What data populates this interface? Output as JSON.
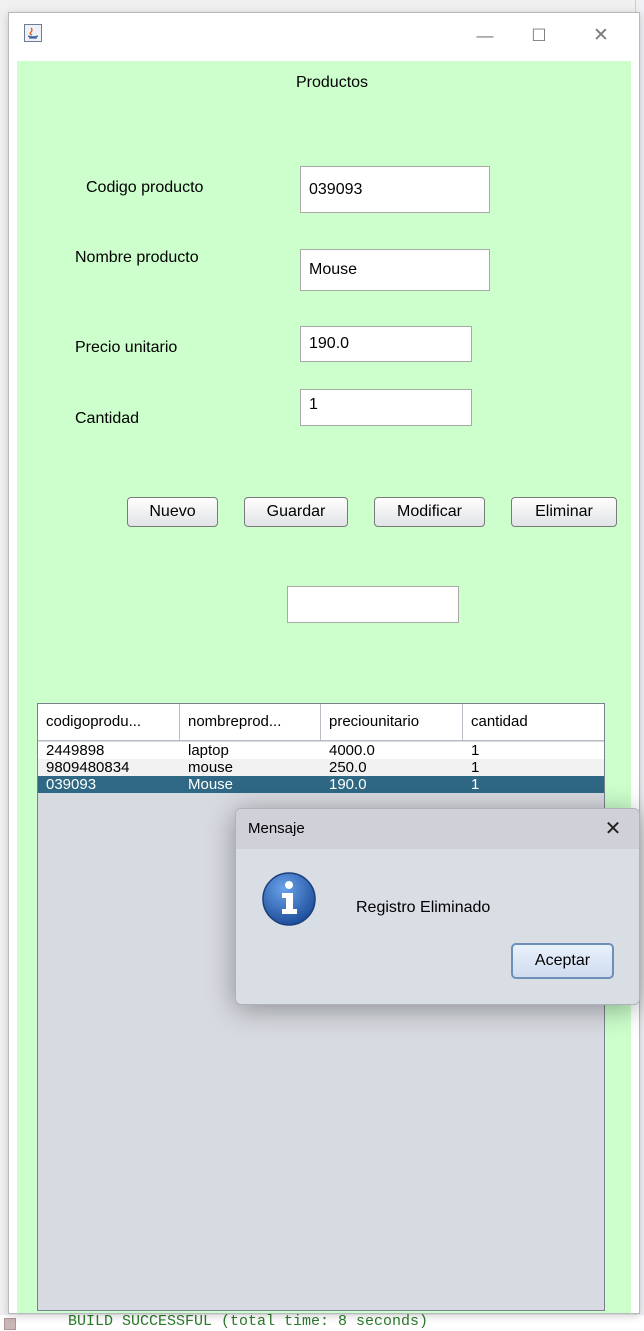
{
  "window": {
    "title": "",
    "minimize_glyph": "—",
    "maximize_glyph": "☐",
    "close_glyph": "✕"
  },
  "form": {
    "heading": "Productos",
    "labels": {
      "codigo": "Codigo producto",
      "nombre": "Nombre producto",
      "precio": "Precio unitario",
      "cantidad": "Cantidad"
    },
    "values": {
      "codigo": "039093",
      "nombre": "Mouse",
      "precio": "190.0",
      "cantidad": "1",
      "extra": ""
    }
  },
  "buttons": {
    "nuevo": "Nuevo",
    "guardar": "Guardar",
    "modificar": "Modificar",
    "eliminar": "Eliminar"
  },
  "table": {
    "columns": [
      "codigoprodu...",
      "nombreprod...",
      "preciounitario",
      "cantidad"
    ],
    "rows": [
      [
        "2449898",
        "laptop",
        "4000.0",
        "1"
      ],
      [
        "9809480834",
        "mouse",
        "250.0",
        "1"
      ],
      [
        "039093",
        "Mouse",
        "190.0",
        "1"
      ]
    ],
    "selected_row": 2
  },
  "dialog": {
    "title": "Mensaje",
    "close_glyph": "✕",
    "message": "Registro Eliminado",
    "ok_label": "Aceptar"
  },
  "ide": {
    "build_output": "BUILD SUCCESSFUL (total time: 8 seconds)"
  },
  "colors": {
    "panel_background": "#ccffcc",
    "selection": "#2e6884",
    "info_icon": "#2f66b5",
    "build_text": "#2a7a2a"
  },
  "icons": {
    "app": "java-app-icon",
    "dialog": "information-icon"
  }
}
